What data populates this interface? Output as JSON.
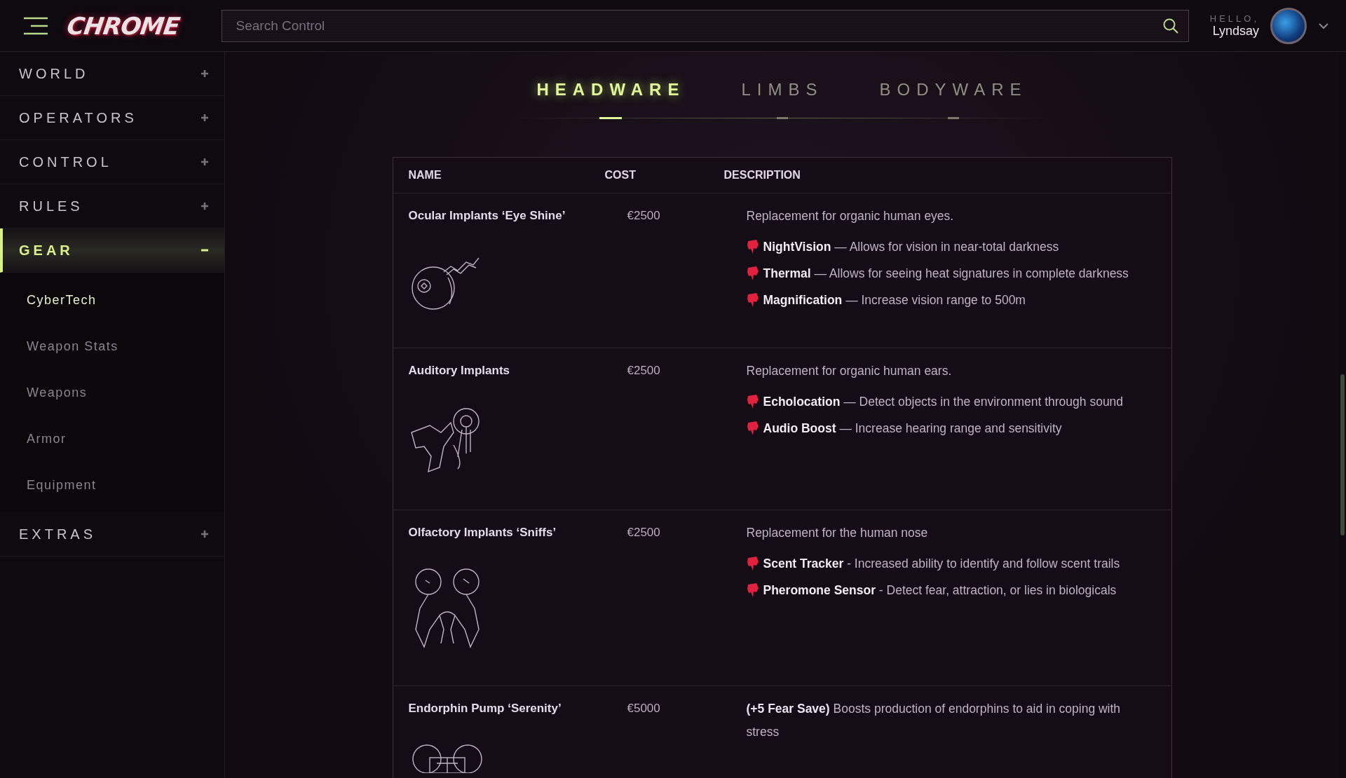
{
  "header": {
    "logo": "CHROME",
    "search": {
      "placeholder": "Search Control"
    },
    "greeting": "HELLO,",
    "user": "Lyndsay"
  },
  "sidebar": {
    "items": [
      {
        "label": "WORLD",
        "expanded": false,
        "selected": false
      },
      {
        "label": "OPERATORS",
        "expanded": false,
        "selected": false
      },
      {
        "label": "CONTROL",
        "expanded": false,
        "selected": false
      },
      {
        "label": "RULES",
        "expanded": false,
        "selected": false
      },
      {
        "label": "GEAR",
        "expanded": true,
        "selected": true,
        "children": [
          {
            "label": "CyberTech",
            "selected": true
          },
          {
            "label": "Weapon Stats",
            "selected": false
          },
          {
            "label": "Weapons",
            "selected": false
          },
          {
            "label": "Armor",
            "selected": false
          },
          {
            "label": "Equipment",
            "selected": false
          }
        ]
      },
      {
        "label": "EXTRAS",
        "expanded": false,
        "selected": false
      }
    ]
  },
  "tabs": [
    {
      "label": "HEADWARE",
      "selected": true
    },
    {
      "label": "LIMBS",
      "selected": false
    },
    {
      "label": "BODYWARE",
      "selected": false
    }
  ],
  "table": {
    "columns": [
      "NAME",
      "COST",
      "DESCRIPTION"
    ],
    "rows": [
      {
        "name": "Ocular Implants ‘Eye Shine’",
        "cost": "€2500",
        "kind": "eye",
        "summary": "Replacement for organic human eyes.",
        "features": [
          "**NightVision** — Allows for vision in near-total darkness",
          "**Thermal** — Allows for seeing heat signatures in complete darkness",
          "**Magnification** — Increase vision range to 500m"
        ]
      },
      {
        "name": "Auditory Implants",
        "cost": "€2500",
        "kind": "ear",
        "summary": "Replacement for organic human ears.",
        "features": [
          "**Echolocation** — Detect objects in the environment through sound",
          "**Audio Boost** — Increase hearing range and sensitivity"
        ]
      },
      {
        "name": "Olfactory Implants ‘Sniffs’",
        "cost": "€2500",
        "kind": "nose",
        "summary": "Replacement for the human nose",
        "features": [
          "**Scent Tracker** - Increased ability to identify and follow scent trails",
          "**Pheromone Sensor** - Detect fear, attraction, or lies in biologicals"
        ]
      },
      {
        "name": "Endorphin Pump ‘Serenity’",
        "cost": "€5000",
        "kind": "pump",
        "summary": "**(+5 Fear Save)** Boosts production of endorphins to aid in coping with stress"
      }
    ]
  }
}
